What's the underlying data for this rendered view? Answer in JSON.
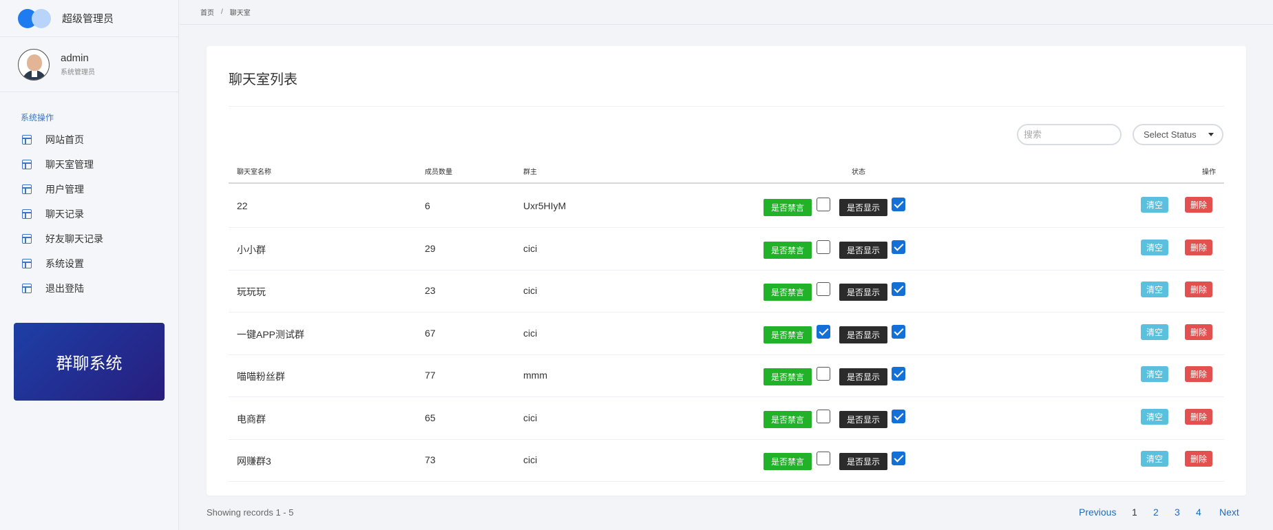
{
  "brand": {
    "name": "超级管理员"
  },
  "user": {
    "name": "admin",
    "role": "系统管理员"
  },
  "menu": {
    "title": "系统操作",
    "items": [
      "网站首页",
      "聊天室管理",
      "用户管理",
      "聊天记录",
      "好友聊天记录",
      "系统设置",
      "退出登陆"
    ]
  },
  "promo": {
    "text": "群聊系统"
  },
  "breadcrumb": {
    "home": "首页",
    "separator": "/",
    "current": "聊天室"
  },
  "card": {
    "title": "聊天室列表"
  },
  "search": {
    "placeholder": "搜索"
  },
  "status_select": {
    "value": "Select Status"
  },
  "table": {
    "headers": {
      "name": "聊天室名称",
      "members": "成员数量",
      "owner": "群主",
      "status": "状态",
      "actions": "操作"
    },
    "mute_label": "是否禁言",
    "show_label": "是否显示",
    "clear_label": "清空",
    "delete_label": "删除",
    "rows": [
      {
        "name": "22",
        "members": "6",
        "owner": "Uxr5HIyM",
        "muted": false,
        "shown": true
      },
      {
        "name": "小小群",
        "members": "29",
        "owner": "cici",
        "muted": false,
        "shown": true
      },
      {
        "name": "玩玩玩",
        "members": "23",
        "owner": "cici",
        "muted": false,
        "shown": true
      },
      {
        "name": "一键APP测试群",
        "members": "67",
        "owner": "cici",
        "muted": true,
        "shown": true
      },
      {
        "name": "喵喵粉丝群",
        "members": "77",
        "owner": "mmm",
        "muted": false,
        "shown": true
      },
      {
        "name": "电商群",
        "members": "65",
        "owner": "cici",
        "muted": false,
        "shown": true
      },
      {
        "name": "网赚群3",
        "members": "73",
        "owner": "cici",
        "muted": false,
        "shown": true
      }
    ]
  },
  "footer": {
    "records": "Showing records 1 - 5"
  },
  "pagination": {
    "previous": "Previous",
    "pages": [
      "1",
      "2",
      "3",
      "4"
    ],
    "current": "1",
    "next": "Next"
  }
}
